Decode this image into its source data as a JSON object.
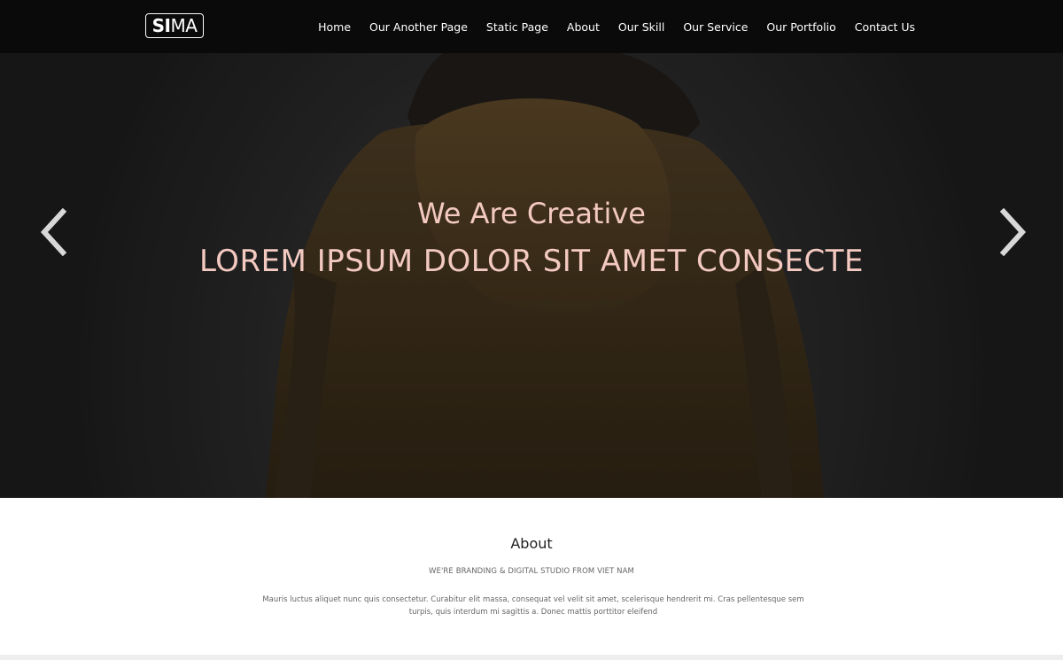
{
  "brand": {
    "logo_bold": "SI",
    "logo_thin": "MA"
  },
  "nav": {
    "items": [
      {
        "label": "Home"
      },
      {
        "label": "Our Another Page"
      },
      {
        "label": "Static Page"
      },
      {
        "label": "About"
      },
      {
        "label": "Our Skill"
      },
      {
        "label": "Our Service"
      },
      {
        "label": "Our Portfolio"
      },
      {
        "label": "Contact Us"
      }
    ]
  },
  "hero": {
    "subtitle": "We Are Creative",
    "title": "LOREM IPSUM DOLOR SIT AMET CONSECTE",
    "text_color": "#f3c9c0",
    "prev_icon": "chevron-left-icon",
    "next_icon": "chevron-right-icon"
  },
  "about": {
    "title": "About",
    "tagline": "WE'RE BRANDING & DIGITAL STUDIO FROM VIET NAM",
    "body": "Mauris luctus aliquet nunc quis consectetur. Curabitur elit massa, consequat vel velit sit amet, scelerisque hendrerit mi. Cras pellentesque sem turpis, quis interdum mi sagittis a. Donec mattis porttitor eleifend"
  }
}
